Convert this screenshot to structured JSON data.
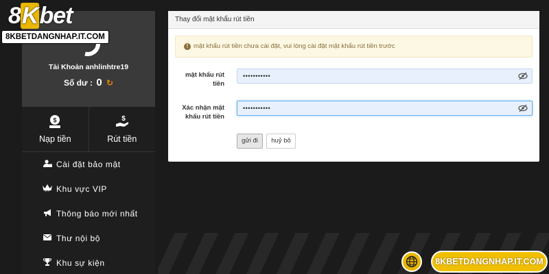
{
  "logo": {
    "pre": "8",
    "k": "K",
    "post": "bet",
    "domain": "8KBETDANGNHAP.IT.COM"
  },
  "profile": {
    "account": "Tài Khoản anhlinhtre19",
    "balance_label": "Số dư :",
    "balance_value": "0"
  },
  "actions": [
    {
      "label": "Nạp tiền",
      "icon": "money-bag-icon"
    },
    {
      "label": "Rút tiền",
      "icon": "hand-money-icon"
    }
  ],
  "menu": [
    {
      "label": "Cài đặt bảo mật",
      "icon": "user-lock-icon"
    },
    {
      "label": "Khu vực VIP",
      "icon": "crown-icon"
    },
    {
      "label": "Thông báo mới nhất",
      "icon": "megaphone-icon"
    },
    {
      "label": "Thư nội bộ",
      "icon": "envelope-icon"
    },
    {
      "label": "Khu sự kiện",
      "icon": "trophy-icon"
    }
  ],
  "panel": {
    "title": "Thay đổi mật khẩu rút tiền",
    "alert": "mật khẩu rút tiền chưa cài đặt, vui lòng cài đặt mật khẩu rút tiền trước",
    "field1_label": "mật khẩu rút tiền",
    "field1_value": "•••••••••••",
    "field2_label": "Xác nhận mật khẩu rút tiền",
    "field2_value": "•••••••••••",
    "submit": "gửi đi",
    "cancel": "huỷ bỏ"
  },
  "footer": {
    "domain": "8KBETDANGNHAP.IT.COM"
  },
  "colors": {
    "accent": "#e9b600",
    "sidebar": "#1e1e1e",
    "profile": "#3a3a3a",
    "alert_bg": "#fcf8e3"
  }
}
